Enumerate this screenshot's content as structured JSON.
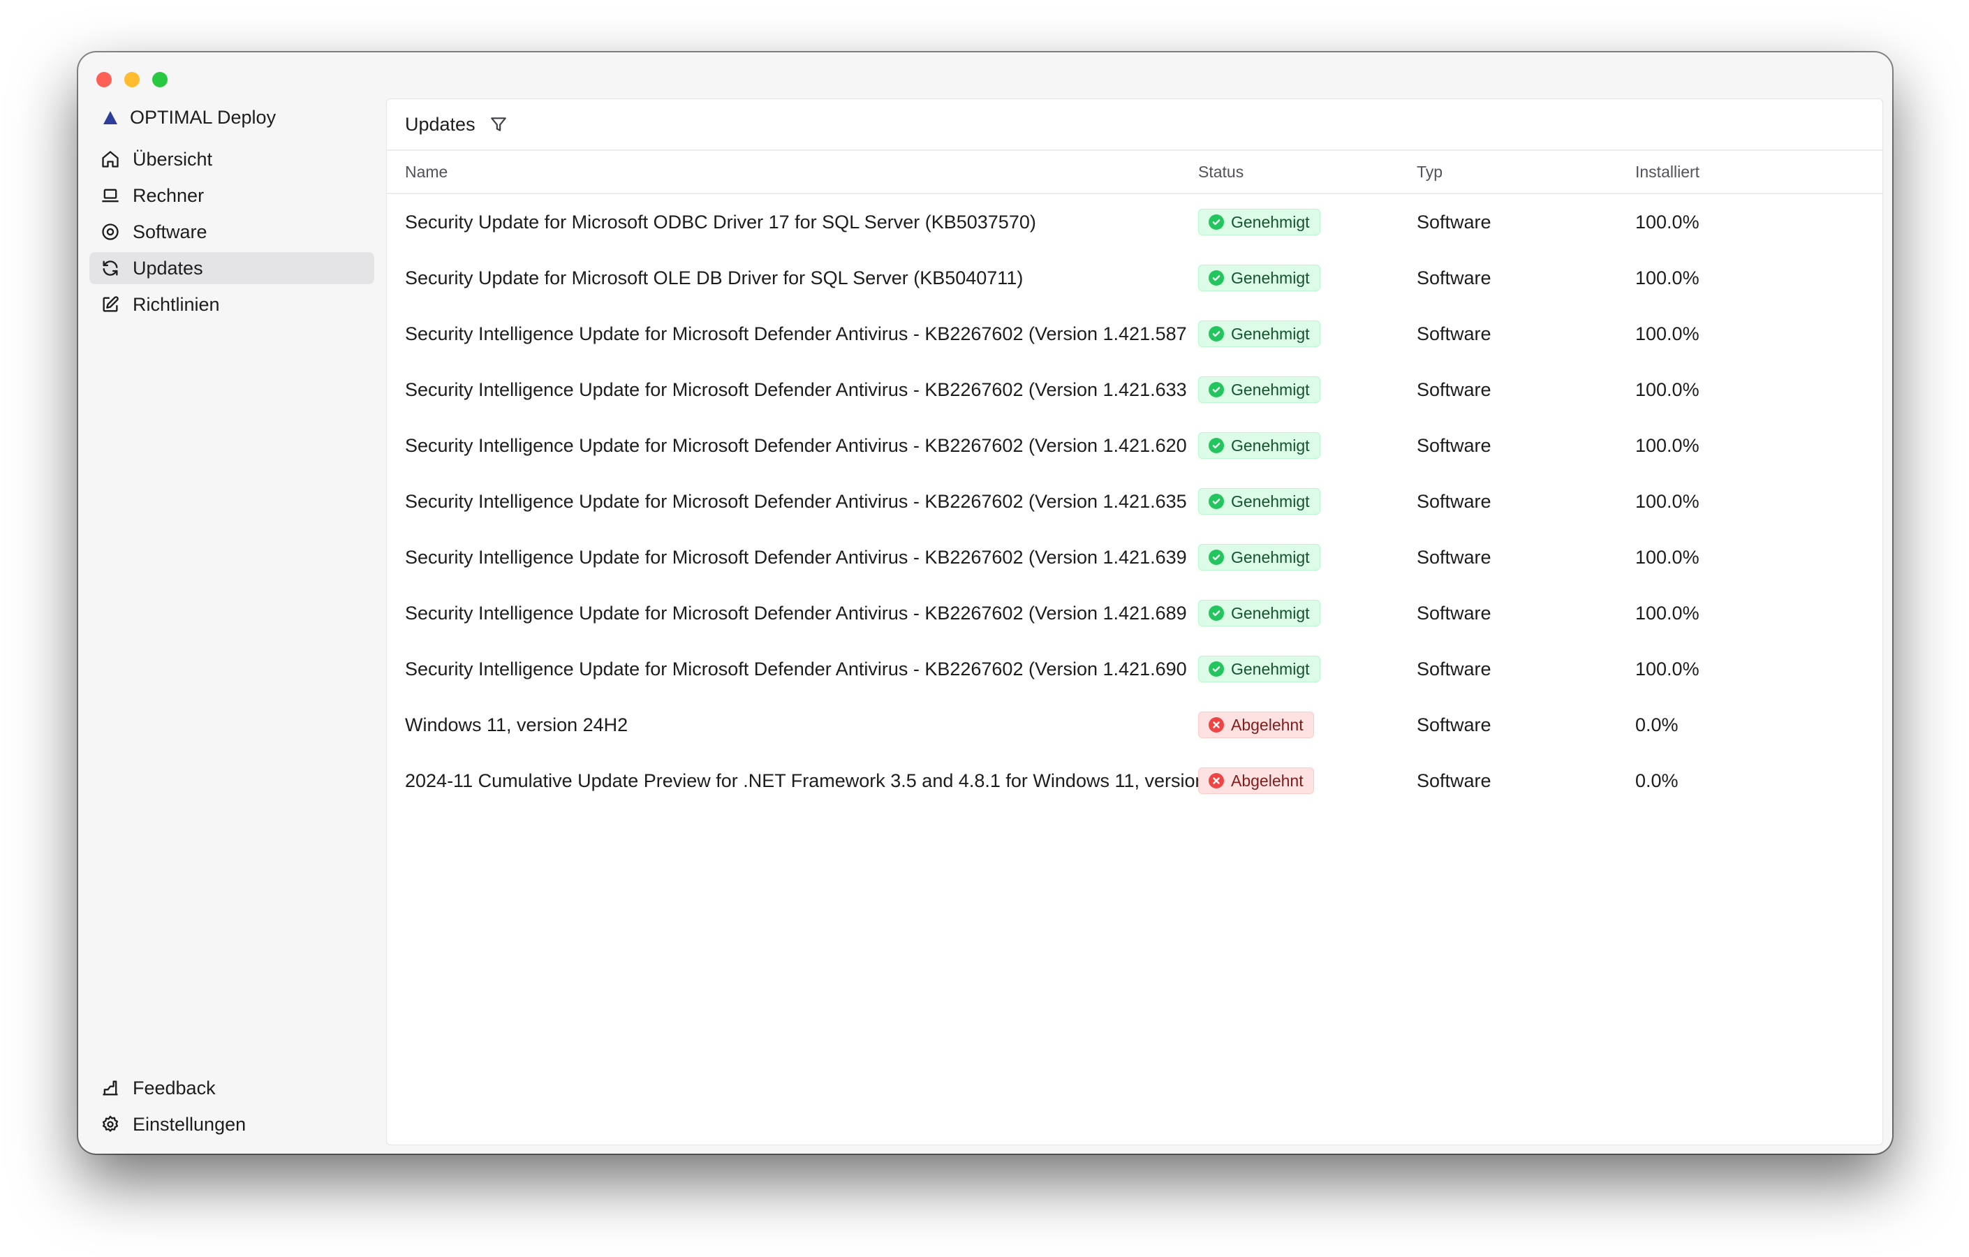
{
  "app": {
    "name": "OPTIMAL Deploy"
  },
  "sidebar": {
    "items": [
      {
        "label": "Übersicht",
        "icon": "home-icon"
      },
      {
        "label": "Rechner",
        "icon": "laptop-icon"
      },
      {
        "label": "Software",
        "icon": "software-icon"
      },
      {
        "label": "Updates",
        "icon": "refresh-icon",
        "active": true
      },
      {
        "label": "Richtlinien",
        "icon": "edit-icon"
      }
    ],
    "bottom": [
      {
        "label": "Feedback",
        "icon": "feedback-icon"
      },
      {
        "label": "Einstellungen",
        "icon": "gear-icon"
      }
    ]
  },
  "main": {
    "title": "Updates",
    "columns": {
      "name": "Name",
      "status": "Status",
      "type": "Typ",
      "installed": "Installiert"
    },
    "rows": [
      {
        "name": "Security Update for Microsoft ODBC Driver 17 for SQL Server (KB5037570)",
        "status": "Genehmigt",
        "type": "Software",
        "installed": "100.0%"
      },
      {
        "name": "Security Update for Microsoft OLE DB Driver for SQL Server (KB5040711)",
        "status": "Genehmigt",
        "type": "Software",
        "installed": "100.0%"
      },
      {
        "name": "Security Intelligence Update for Microsoft Defender Antivirus - KB2267602 (Version 1.421.587",
        "status": "Genehmigt",
        "type": "Software",
        "installed": "100.0%"
      },
      {
        "name": "Security Intelligence Update for Microsoft Defender Antivirus - KB2267602 (Version 1.421.633",
        "status": "Genehmigt",
        "type": "Software",
        "installed": "100.0%"
      },
      {
        "name": "Security Intelligence Update for Microsoft Defender Antivirus - KB2267602 (Version 1.421.620",
        "status": "Genehmigt",
        "type": "Software",
        "installed": "100.0%"
      },
      {
        "name": "Security Intelligence Update for Microsoft Defender Antivirus - KB2267602 (Version 1.421.635",
        "status": "Genehmigt",
        "type": "Software",
        "installed": "100.0%"
      },
      {
        "name": "Security Intelligence Update for Microsoft Defender Antivirus - KB2267602 (Version 1.421.639",
        "status": "Genehmigt",
        "type": "Software",
        "installed": "100.0%"
      },
      {
        "name": "Security Intelligence Update for Microsoft Defender Antivirus - KB2267602 (Version 1.421.689",
        "status": "Genehmigt",
        "type": "Software",
        "installed": "100.0%"
      },
      {
        "name": "Security Intelligence Update for Microsoft Defender Antivirus - KB2267602 (Version 1.421.690",
        "status": "Genehmigt",
        "type": "Software",
        "installed": "100.0%"
      },
      {
        "name": "Windows 11, version 24H2",
        "status": "Abgelehnt",
        "type": "Software",
        "installed": "0.0%"
      },
      {
        "name": "2024-11 Cumulative Update Preview for .NET Framework 3.5 and 4.8.1 for Windows 11, version",
        "status": "Abgelehnt",
        "type": "Software",
        "installed": "0.0%"
      }
    ]
  },
  "colors": {
    "approved": "#22c55e",
    "rejected": "#ef4444",
    "brand": "#2c3e9a",
    "active_nav": "#e4e4e7"
  }
}
